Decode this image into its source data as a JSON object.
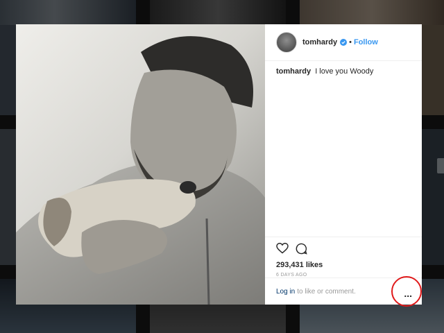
{
  "post": {
    "username": "tomhardy",
    "dot": "•",
    "follow_label": "Follow",
    "caption_user": "tomhardy",
    "caption_text": "I love you Woody",
    "likes": "293,431 likes",
    "time_ago": "6 DAYS AGO",
    "login_link": "Log in",
    "login_suffix": "to like or comment.",
    "more_label": "..."
  },
  "icons": {
    "like": "heart-icon",
    "comment": "comment-icon",
    "verified": "verified-badge-icon",
    "more": "more-options-icon"
  },
  "colors": {
    "follow": "#3897f0",
    "highlight": "#e0191a",
    "login_link": "#003569"
  }
}
